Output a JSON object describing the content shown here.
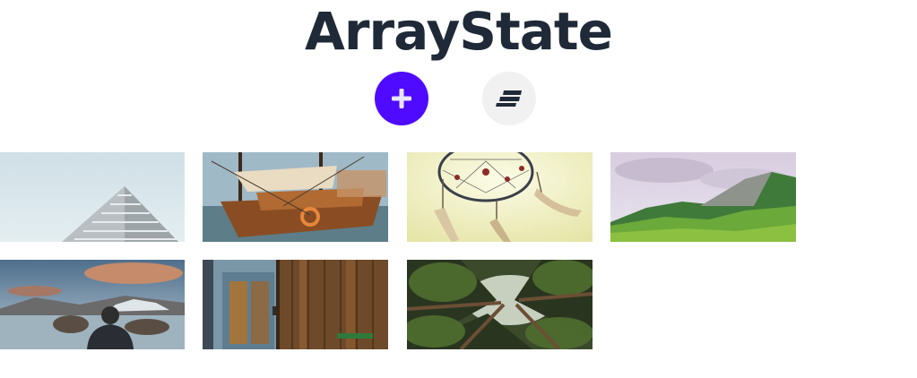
{
  "header": {
    "title": "ArrayState"
  },
  "toolbar": {
    "add_icon": "plus-icon",
    "sort_icon": "sort-lines-icon",
    "add_color": "#4f0bff",
    "sort_color": "#f1f1f2"
  },
  "gallery": {
    "images": [
      {
        "subject": "white-building-against-sky"
      },
      {
        "subject": "wooden-sailing-ship"
      },
      {
        "subject": "dreamcatcher-sunlight"
      },
      {
        "subject": "green-mountain-landscape"
      },
      {
        "subject": "person-at-mountain-lake"
      },
      {
        "subject": "weathered-wooden-doors"
      },
      {
        "subject": "forest-canopy-looking-up"
      }
    ]
  }
}
